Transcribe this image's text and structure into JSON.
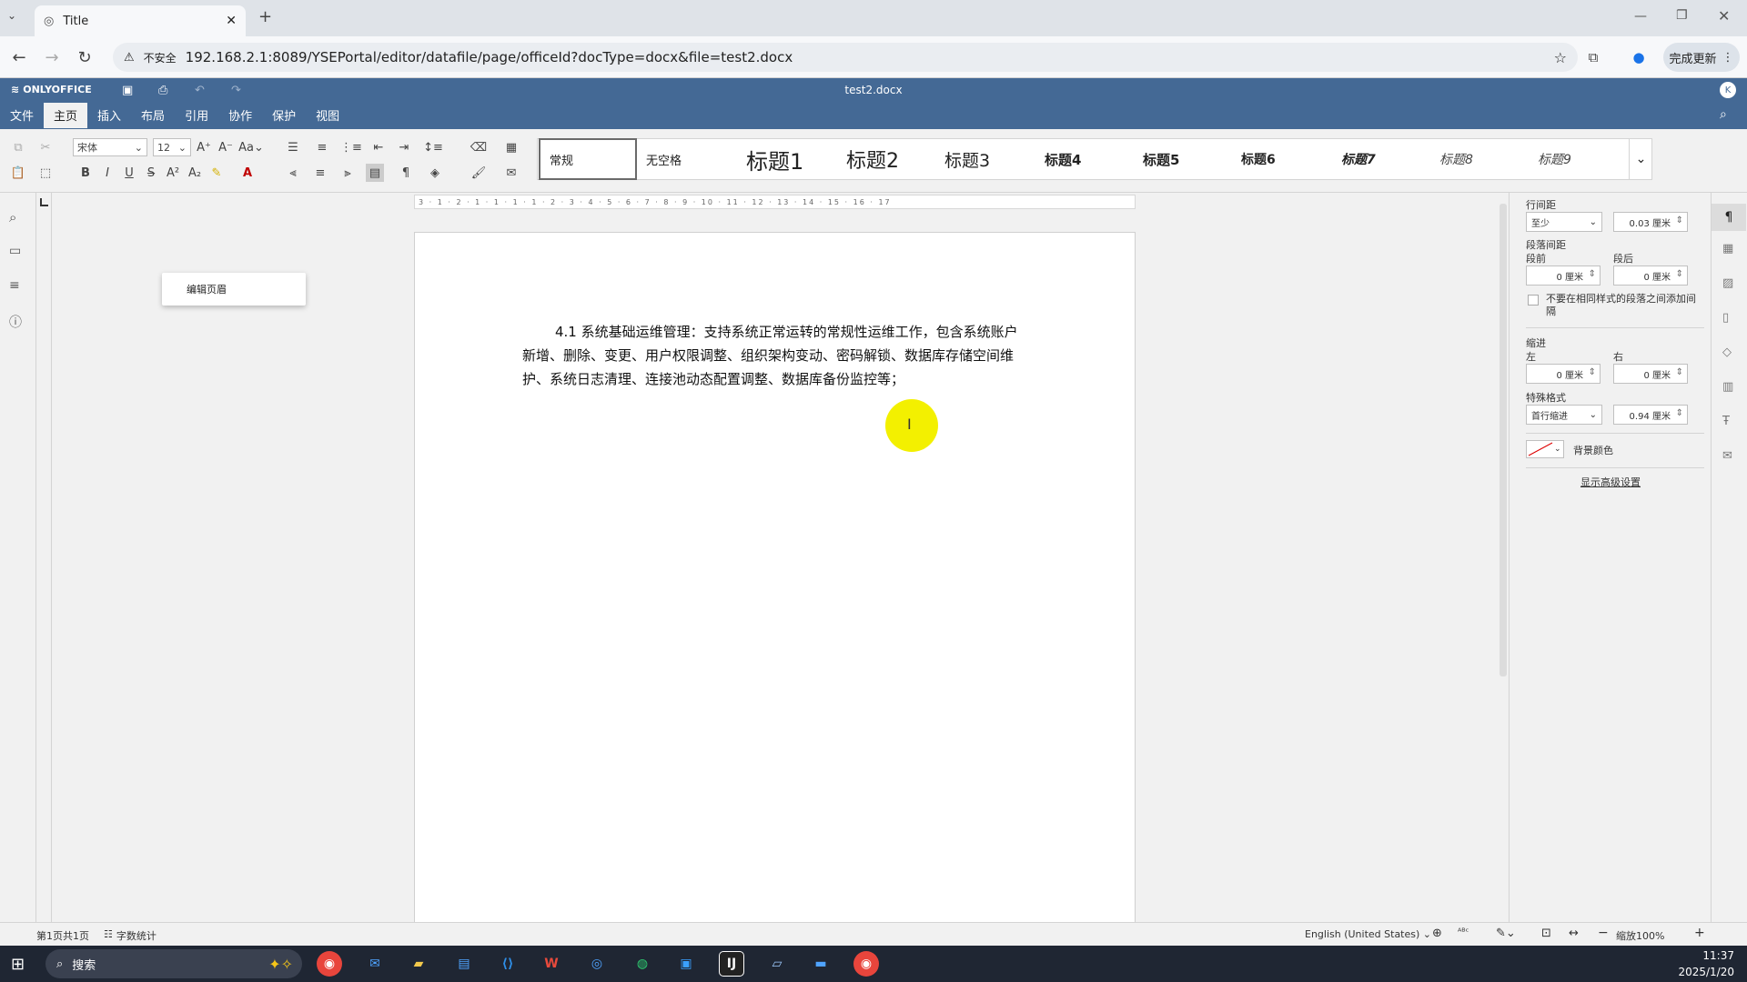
{
  "browser": {
    "tab_title": "Title",
    "security_label": "不安全",
    "url": "192.168.2.1:8089/YSEPortal/editor/datafile/page/officeId?docType=docx&file=test2.docx",
    "update_button": "完成更新"
  },
  "editor": {
    "brand": "ONLYOFFICE",
    "doc_title": "test2.docx",
    "avatar_letter": "K",
    "menu": [
      "文件",
      "主页",
      "插入",
      "布局",
      "引用",
      "协作",
      "保护",
      "视图"
    ],
    "active_menu": "主页",
    "font_name": "宋体",
    "font_size": "12",
    "styles": [
      "常规",
      "无空格",
      "标题1",
      "标题2",
      "标题3",
      "标题4",
      "标题5",
      "标题6",
      "标题7",
      "标题8",
      "标题9"
    ]
  },
  "ruler": {
    "h_ticks": "3 · 1 · 2 · 1 · 1 · 1 · 1 · 2 · 3 · 4 · 5 · 6 · 7 · 8 · 9 · 10 · 11 · 12 · 13 · 14 · 15 · 16 · 17"
  },
  "popup": {
    "label": "编辑页眉"
  },
  "document": {
    "paragraph": "4.1 系统基础运维管理：支持系统正常运转的常规性运维工作，包含系统账户新增、删除、变更、用户权限调整、组织架构变动、密码解锁、数据库存储空间维护、系统日志清理、连接池动态配置调整、数据库备份监控等；"
  },
  "paragraph_settings": {
    "line_spacing_label": "行间距",
    "line_spacing_mode": "至少",
    "line_spacing_value": "0.03 厘米",
    "para_spacing_label": "段落间距",
    "before_label": "段前",
    "after_label": "段后",
    "before_value": "0 厘米",
    "after_value": "0 厘米",
    "no_space_checkbox": "不要在相同样式的段落之间添加间隔",
    "indent_label": "缩进",
    "left_label": "左",
    "right_label": "右",
    "left_value": "0 厘米",
    "right_value": "0 厘米",
    "special_label": "特殊格式",
    "special_mode": "首行缩进",
    "special_value": "0.94 厘米",
    "bg_color_label": "背景颜色",
    "advanced_link": "显示高级设置"
  },
  "status": {
    "page_info": "第1页共1页",
    "word_count": "字数统计",
    "language": "English (United States)",
    "zoom": "缩放100%"
  },
  "taskbar": {
    "search_placeholder": "搜索",
    "time": "11:37",
    "date": "2025/1/20"
  }
}
